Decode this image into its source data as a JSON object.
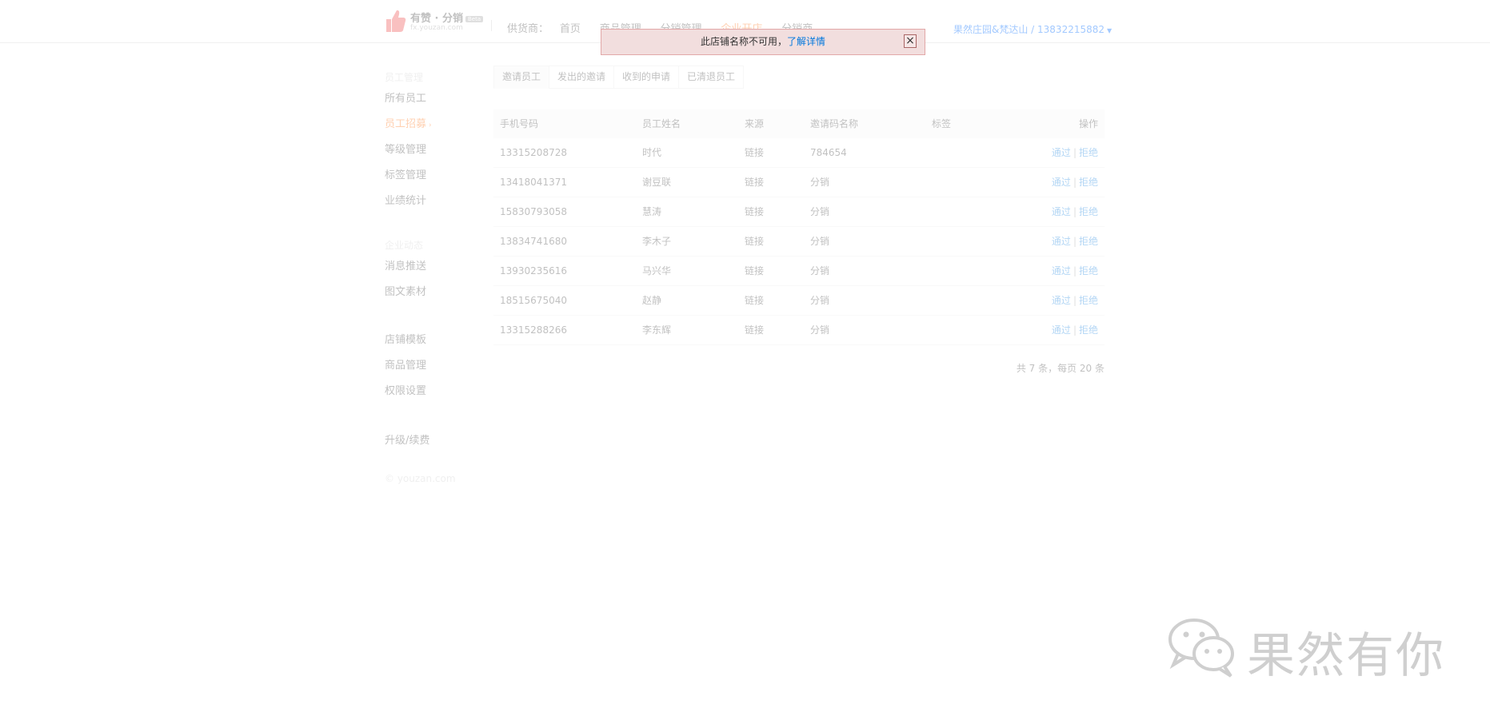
{
  "header": {
    "brand": "有赞 · 分销",
    "brand_badge": "Beta",
    "domain": "fx.youzan.com",
    "supplier_label": "供货商：",
    "nav": [
      {
        "label": "首页"
      },
      {
        "label": "商品管理"
      },
      {
        "label": "分销管理"
      },
      {
        "label": "企业开店"
      },
      {
        "label": "分销商"
      }
    ],
    "user": "果然庄园&梵达山 / 13832215882"
  },
  "sidebar": {
    "group1_title": "员工管理",
    "group1_items": [
      "所有员工",
      "员工招募",
      "等级管理",
      "标签管理",
      "业绩统计"
    ],
    "group2_title": "企业动态",
    "group2_items": [
      "消息推送",
      "图文素材"
    ],
    "group3_items": [
      "店铺模板",
      "商品管理",
      "权限设置"
    ],
    "upgrade": "升级/续费",
    "footer": "© youzan.com"
  },
  "tabs": [
    "邀请员工",
    "发出的邀请",
    "收到的申请",
    "已清退员工"
  ],
  "table": {
    "headers": [
      "手机号码",
      "员工姓名",
      "来源",
      "邀请码名称",
      "标签",
      "操作"
    ],
    "rows": [
      {
        "phone": "13315208728",
        "name": "时代",
        "source": "链接",
        "code": "784654",
        "tag": ""
      },
      {
        "phone": "13418041371",
        "name": "谢豆联",
        "source": "链接",
        "code": "分销",
        "tag": ""
      },
      {
        "phone": "15830793058",
        "name": "慧涛",
        "source": "链接",
        "code": "分销",
        "tag": ""
      },
      {
        "phone": "13834741680",
        "name": "李木子",
        "source": "链接",
        "code": "分销",
        "tag": ""
      },
      {
        "phone": "13930235616",
        "name": "马兴华",
        "source": "链接",
        "code": "分销",
        "tag": ""
      },
      {
        "phone": "18515675040",
        "name": "赵静",
        "source": "链接",
        "code": "分销",
        "tag": ""
      },
      {
        "phone": "13315288266",
        "name": "李东辉",
        "source": "链接",
        "code": "分销",
        "tag": ""
      }
    ],
    "action_approve": "通过",
    "action_sep": "|",
    "action_reject": "拒绝"
  },
  "pager": "共 7 条，每页 20 条",
  "alert": {
    "message": "此店铺名称不可用，",
    "link": "了解详情",
    "close": "×"
  },
  "watermark": {
    "text": "果然有你",
    "icon": "wechat-icon"
  },
  "colors": {
    "accent": "#ff6600",
    "link": "#0077dd",
    "alert_bg": "#f2dede",
    "alert_border": "#e2a8a8"
  }
}
